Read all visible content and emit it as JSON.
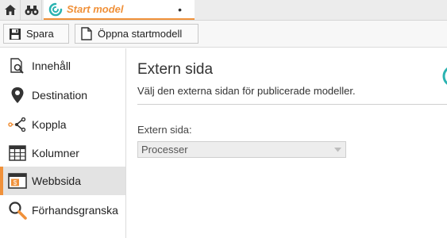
{
  "tabbar": {
    "home_icon": "home-icon",
    "search_icon": "binoculars-icon",
    "active_tab": {
      "title": "Start model",
      "modified_marker": "•",
      "accent": "#f0913a"
    }
  },
  "toolbar": {
    "save_label": "Spara",
    "open_label": "Öppna startmodell"
  },
  "sidebar": {
    "items": [
      {
        "label": "Innehåll",
        "icon": "content-icon"
      },
      {
        "label": "Destination",
        "icon": "map-pin-icon"
      },
      {
        "label": "Koppla",
        "icon": "connect-icon"
      },
      {
        "label": "Kolumner",
        "icon": "columns-icon"
      },
      {
        "label": "Webbsida",
        "icon": "webpage-icon",
        "active": true
      },
      {
        "label": "Förhandsgranska",
        "icon": "preview-icon"
      }
    ]
  },
  "main": {
    "title": "Extern sida",
    "description": "Välj den externa sidan för publicerade modeller.",
    "field_label": "Extern sida:",
    "select_value": "Processer"
  },
  "colors": {
    "accent": "#f0913a",
    "teal": "#2ab3b1"
  }
}
